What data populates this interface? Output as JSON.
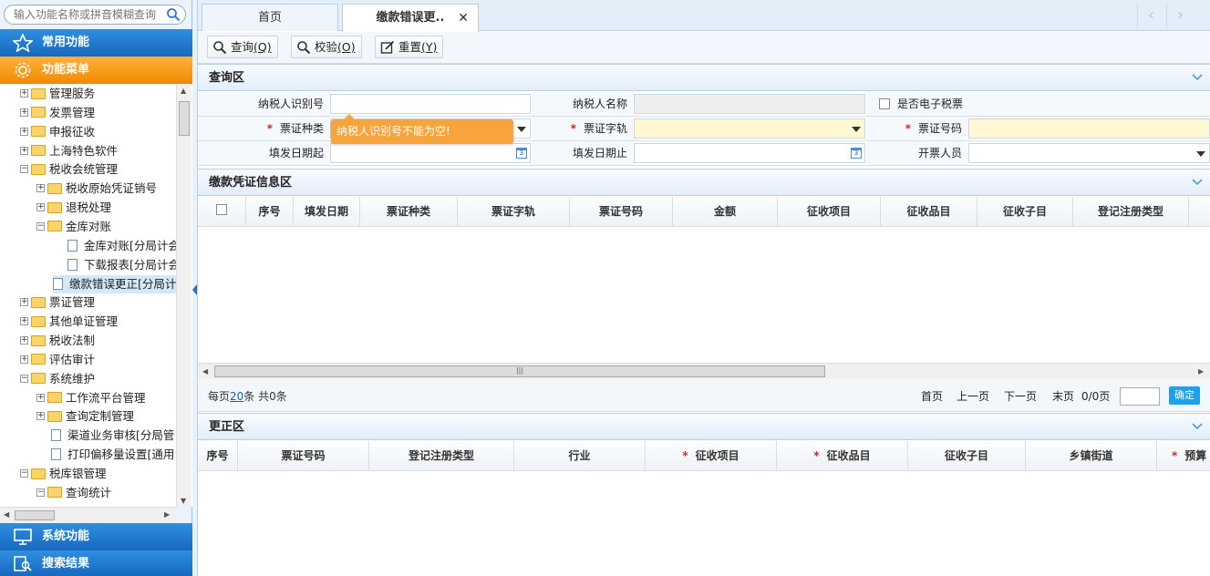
{
  "search": {
    "placeholder": "输入功能名称或拼音模糊查询"
  },
  "nav": {
    "common": "常用功能",
    "menu": "功能菜单",
    "system": "系统功能",
    "search_results": "搜索结果"
  },
  "tree": [
    {
      "label": "管理服务",
      "type": "folder",
      "expanded": false,
      "level": 0
    },
    {
      "label": "发票管理",
      "type": "folder",
      "expanded": false,
      "level": 0
    },
    {
      "label": "申报征收",
      "type": "folder",
      "expanded": false,
      "level": 0
    },
    {
      "label": "上海特色软件",
      "type": "folder",
      "expanded": false,
      "level": 0
    },
    {
      "label": "税收会统管理",
      "type": "folder",
      "expanded": true,
      "level": 0
    },
    {
      "label": "税收原始凭证销号",
      "type": "folder",
      "expanded": false,
      "level": 1
    },
    {
      "label": "退税处理",
      "type": "folder",
      "expanded": false,
      "level": 1
    },
    {
      "label": "金库对账",
      "type": "folder",
      "expanded": true,
      "level": 1
    },
    {
      "label": "金库对账[分局计会",
      "type": "doc",
      "level": 2
    },
    {
      "label": "下载报表[分局计会",
      "type": "doc",
      "level": 2
    },
    {
      "label": "缴款错误更正[分局计",
      "type": "doc",
      "level": 1,
      "selected": true
    },
    {
      "label": "票证管理",
      "type": "folder",
      "expanded": false,
      "level": 0
    },
    {
      "label": "其他单证管理",
      "type": "folder",
      "expanded": false,
      "level": 0
    },
    {
      "label": "税收法制",
      "type": "folder",
      "expanded": false,
      "level": 0
    },
    {
      "label": "评估审计",
      "type": "folder",
      "expanded": false,
      "level": 0
    },
    {
      "label": "系统维护",
      "type": "folder",
      "expanded": true,
      "level": 0
    },
    {
      "label": "工作流平台管理",
      "type": "folder",
      "expanded": false,
      "level": 1
    },
    {
      "label": "查询定制管理",
      "type": "folder",
      "expanded": false,
      "level": 1
    },
    {
      "label": "渠道业务审核[分局管",
      "type": "doc",
      "level": 1
    },
    {
      "label": "打印偏移量设置[通用",
      "type": "doc",
      "level": 1
    },
    {
      "label": "税库银管理",
      "type": "folder",
      "expanded": true,
      "level": 0
    },
    {
      "label": "查询统计",
      "type": "folder",
      "expanded": true,
      "level": 1
    }
  ],
  "tabs": [
    {
      "label": "首页",
      "active": false
    },
    {
      "label": "缴款错误更..",
      "active": true
    }
  ],
  "toolbar": {
    "query": {
      "text": "查询",
      "key": "(Q)"
    },
    "check": {
      "text": "校验",
      "key": "(O)"
    },
    "reset": {
      "text": "重置",
      "key": "(Y)"
    }
  },
  "query_section": {
    "title": "查询区",
    "taxpayer_id_label": "纳税人识别号",
    "taxpayer_name_label": "纳税人名称",
    "e_ticket_label": "是否电子税票",
    "ticket_type_label": "票证种类",
    "ticket_track_label": "票证字轨",
    "ticket_no_label": "票证号码",
    "date_from_label": "填发日期起",
    "date_to_label": "填发日期止",
    "issuer_label": "开票人员",
    "tooltip": "纳税人识别号不能为空!"
  },
  "info_section": {
    "title": "缴款凭证信息区",
    "columns": [
      "序号",
      "填发日期",
      "票证种类",
      "票证字轨",
      "票证号码",
      "金额",
      "征收项目",
      "征收品目",
      "征收子目",
      "登记注册类型"
    ],
    "rows": []
  },
  "pager": {
    "per_page_prefix": "每页",
    "per_page": "20",
    "per_page_suffix": "条 共0条",
    "first": "首页",
    "prev": "上一页",
    "next": "下一页",
    "last": "末页",
    "page_info": "0/0页",
    "ok": "确定"
  },
  "correction_section": {
    "title": "更正区",
    "columns": [
      {
        "label": "序号",
        "required": false
      },
      {
        "label": "票证号码",
        "required": false
      },
      {
        "label": "登记注册类型",
        "required": false
      },
      {
        "label": "行业",
        "required": false
      },
      {
        "label": "征收项目",
        "required": true
      },
      {
        "label": "征收品目",
        "required": true
      },
      {
        "label": "征收子目",
        "required": false
      },
      {
        "label": "乡镇街道",
        "required": false
      },
      {
        "label": "预算",
        "required": true
      }
    ]
  },
  "colors": {
    "primary_blue": "#1669bf",
    "accent_orange": "#f08a00",
    "tooltip": "#f7a43c",
    "required": "#e3211e"
  }
}
